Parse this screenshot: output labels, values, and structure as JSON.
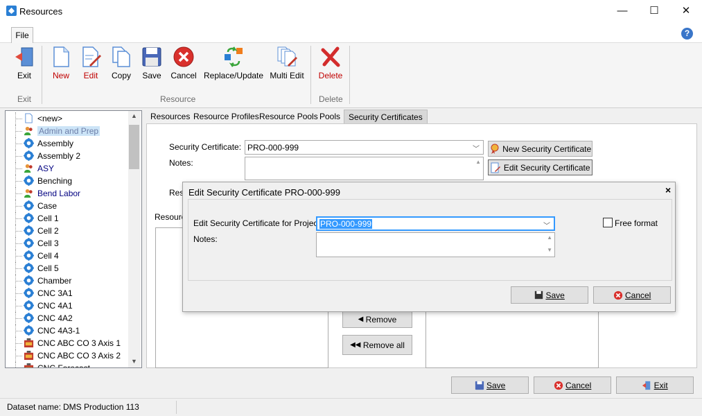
{
  "window": {
    "title": "Resources",
    "minimize": "—",
    "maximize": "☐",
    "close": "✕"
  },
  "menu": {
    "file": "File",
    "help": "?"
  },
  "ribbon": {
    "exit": "Exit",
    "new": "New",
    "edit": "Edit",
    "copy": "Copy",
    "save": "Save",
    "cancel": "Cancel",
    "replace_update": "Replace/Update",
    "multi_edit": "Multi Edit",
    "delete": "Delete",
    "groups": {
      "exit": "Exit",
      "resource": "Resource",
      "delete": "Delete"
    }
  },
  "tree": {
    "items": [
      {
        "label": "<new>",
        "icon": "new-doc-icon",
        "color": "#000000"
      },
      {
        "label": "Admin and Prep",
        "icon": "people-icon",
        "color": "#000080",
        "selected": true
      },
      {
        "label": "Assembly",
        "icon": "gear-icon",
        "color": "#000000"
      },
      {
        "label": "Assembly 2",
        "icon": "gear-icon",
        "color": "#000000"
      },
      {
        "label": "ASY",
        "icon": "people-icon",
        "color": "#000080"
      },
      {
        "label": "Benching",
        "icon": "gear-icon",
        "color": "#000000"
      },
      {
        "label": "Bend Labor",
        "icon": "people-icon",
        "color": "#000080"
      },
      {
        "label": "Case",
        "icon": "gear-icon",
        "color": "#000000"
      },
      {
        "label": "Cell 1",
        "icon": "gear-icon",
        "color": "#000000"
      },
      {
        "label": "Cell 2",
        "icon": "gear-icon",
        "color": "#000000"
      },
      {
        "label": "Cell 3",
        "icon": "gear-icon",
        "color": "#000000"
      },
      {
        "label": "Cell 4",
        "icon": "gear-icon",
        "color": "#000000"
      },
      {
        "label": "Cell 5",
        "icon": "gear-icon",
        "color": "#000000"
      },
      {
        "label": "Chamber",
        "icon": "gear-icon",
        "color": "#000000"
      },
      {
        "label": "CNC 3A1",
        "icon": "gear-icon",
        "color": "#000000"
      },
      {
        "label": "CNC 4A1",
        "icon": "gear-icon",
        "color": "#000000"
      },
      {
        "label": "CNC 4A2",
        "icon": "gear-icon",
        "color": "#000000"
      },
      {
        "label": "CNC 4A3-1",
        "icon": "gear-icon",
        "color": "#000000"
      },
      {
        "label": "CNC ABC CO 3 Axis 1",
        "icon": "machine-icon",
        "color": "#000000"
      },
      {
        "label": "CNC ABC CO 3 Axis 2",
        "icon": "machine-icon",
        "color": "#000000"
      },
      {
        "label": "CNC Forecast",
        "icon": "machine-icon",
        "color": "#000000"
      }
    ]
  },
  "tabs": [
    "Resources",
    "Resource Profiles",
    "Resource Pools",
    "Pools",
    "Security Certificates"
  ],
  "form": {
    "security_certificate_label": "Security Certificate:",
    "security_certificate_value": "PRO-000-999",
    "notes_label": "Notes:",
    "new_cert_button": "New Security Certificate",
    "edit_cert_button": "Edit Security Certificate",
    "res_label_partial": "Res",
    "resource_label_partial": "Resourc",
    "remove_button": "Remove",
    "remove_all_button": "Remove all"
  },
  "dialog": {
    "title": "Edit Security Certificate PRO-000-999",
    "close": "×",
    "project_label": "Edit Security Certificate for Project:",
    "project_value": "PRO-000-999",
    "notes_label": "Notes:",
    "free_format_label": "Free format",
    "save_button": "Save",
    "cancel_button": "Cancel"
  },
  "bottom": {
    "save": "Save",
    "cancel": "Cancel",
    "exit": "Exit"
  },
  "status": {
    "dataset_label": "Dataset name:",
    "dataset_value": "DMS Production 113"
  },
  "colors": {
    "selection": "#cce4f7",
    "highlight": "#3399ff",
    "delete_red": "#cc0000"
  }
}
